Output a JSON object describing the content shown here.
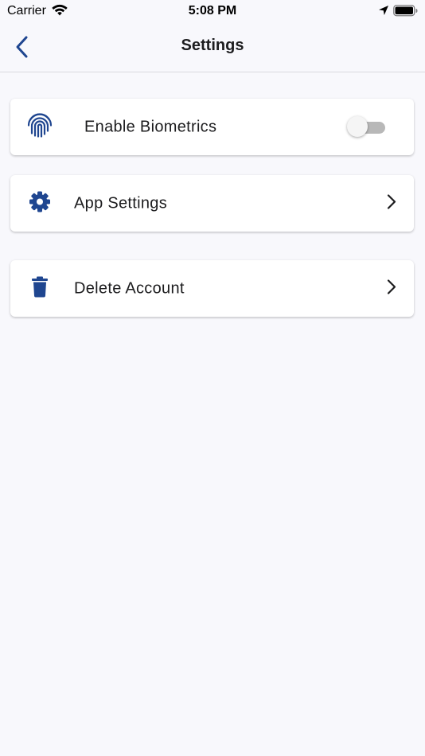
{
  "status_bar": {
    "carrier": "Carrier",
    "time": "5:08 PM",
    "icons": [
      "wifi-icon",
      "location-arrow-icon",
      "battery-icon"
    ]
  },
  "nav": {
    "title": "Settings",
    "back_icon": "chevron-left-icon"
  },
  "settings": {
    "biometrics": {
      "label": "Enable Biometrics",
      "icon": "fingerprint-icon",
      "enabled": false
    },
    "app_settings": {
      "label": "App Settings",
      "icon": "gear-icon"
    },
    "delete_account": {
      "label": "Delete Account",
      "icon": "trash-icon"
    }
  },
  "colors": {
    "accent": "#1f4690",
    "background": "#f8f8fc",
    "card": "#ffffff",
    "toggle_off_track": "#b8b8b8"
  }
}
